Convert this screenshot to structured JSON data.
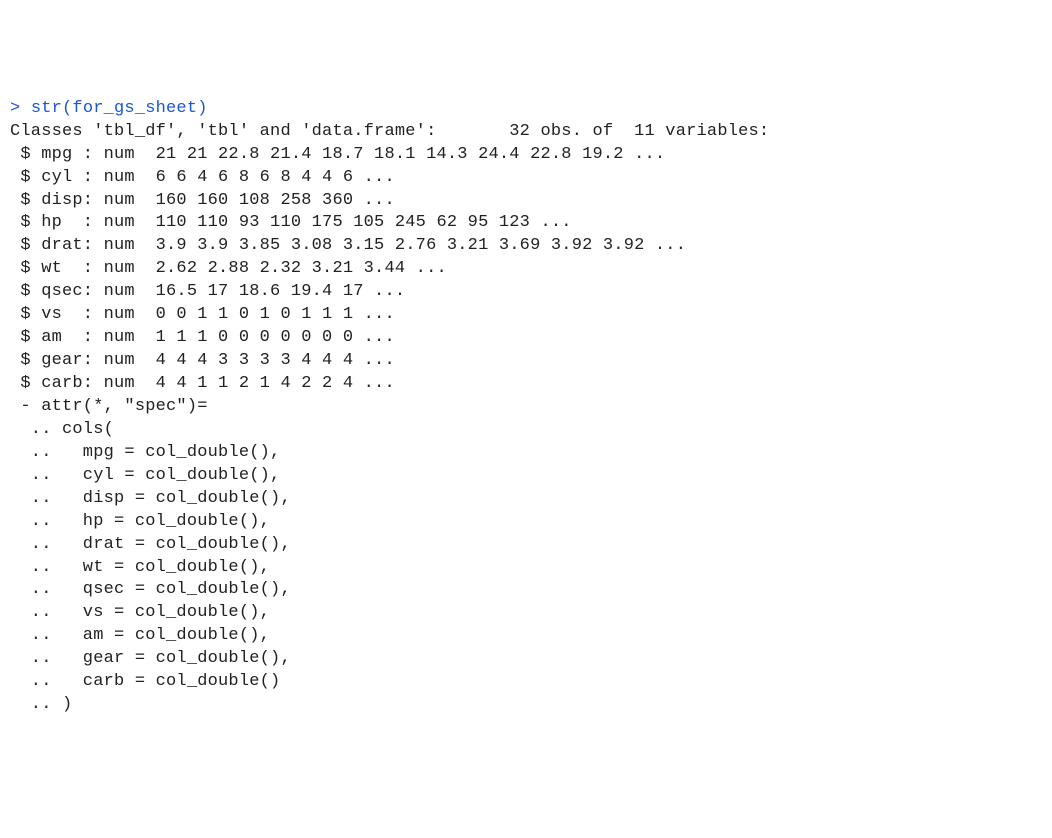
{
  "prompt_symbol": ">",
  "command": "str(for_gs_sheet)",
  "classes_line": "Classes 'tbl_df', 'tbl' and 'data.frame':\t32 obs. of  11 variables:",
  "variables": [
    {
      "name": "mpg ",
      "type": "num",
      "values": "21 21 22.8 21.4 18.7 18.1 14.3 24.4 22.8 19.2 ..."
    },
    {
      "name": "cyl ",
      "type": "num",
      "values": "6 6 4 6 8 6 8 4 4 6 ..."
    },
    {
      "name": "disp",
      "type": "num",
      "values": "160 160 108 258 360 ..."
    },
    {
      "name": "hp  ",
      "type": "num",
      "values": "110 110 93 110 175 105 245 62 95 123 ..."
    },
    {
      "name": "drat",
      "type": "num",
      "values": "3.9 3.9 3.85 3.08 3.15 2.76 3.21 3.69 3.92 3.92 ..."
    },
    {
      "name": "wt  ",
      "type": "num",
      "values": "2.62 2.88 2.32 3.21 3.44 ..."
    },
    {
      "name": "qsec",
      "type": "num",
      "values": "16.5 17 18.6 19.4 17 ..."
    },
    {
      "name": "vs  ",
      "type": "num",
      "values": "0 0 1 1 0 1 0 1 1 1 ..."
    },
    {
      "name": "am  ",
      "type": "num",
      "values": "1 1 1 0 0 0 0 0 0 0 ..."
    },
    {
      "name": "gear",
      "type": "num",
      "values": "4 4 4 3 3 3 3 4 4 4 ..."
    },
    {
      "name": "carb",
      "type": "num",
      "values": "4 4 1 1 2 1 4 2 2 4 ..."
    }
  ],
  "attr_line": " - attr(*, \"spec\")=",
  "cols_open": "  .. cols(",
  "spec_cols": [
    "mpg = col_double(),",
    "cyl = col_double(),",
    "disp = col_double(),",
    "hp = col_double(),",
    "drat = col_double(),",
    "wt = col_double(),",
    "qsec = col_double(),",
    "vs = col_double(),",
    "am = col_double(),",
    "gear = col_double(),",
    "carb = col_double()"
  ],
  "cols_close": "  .. )"
}
